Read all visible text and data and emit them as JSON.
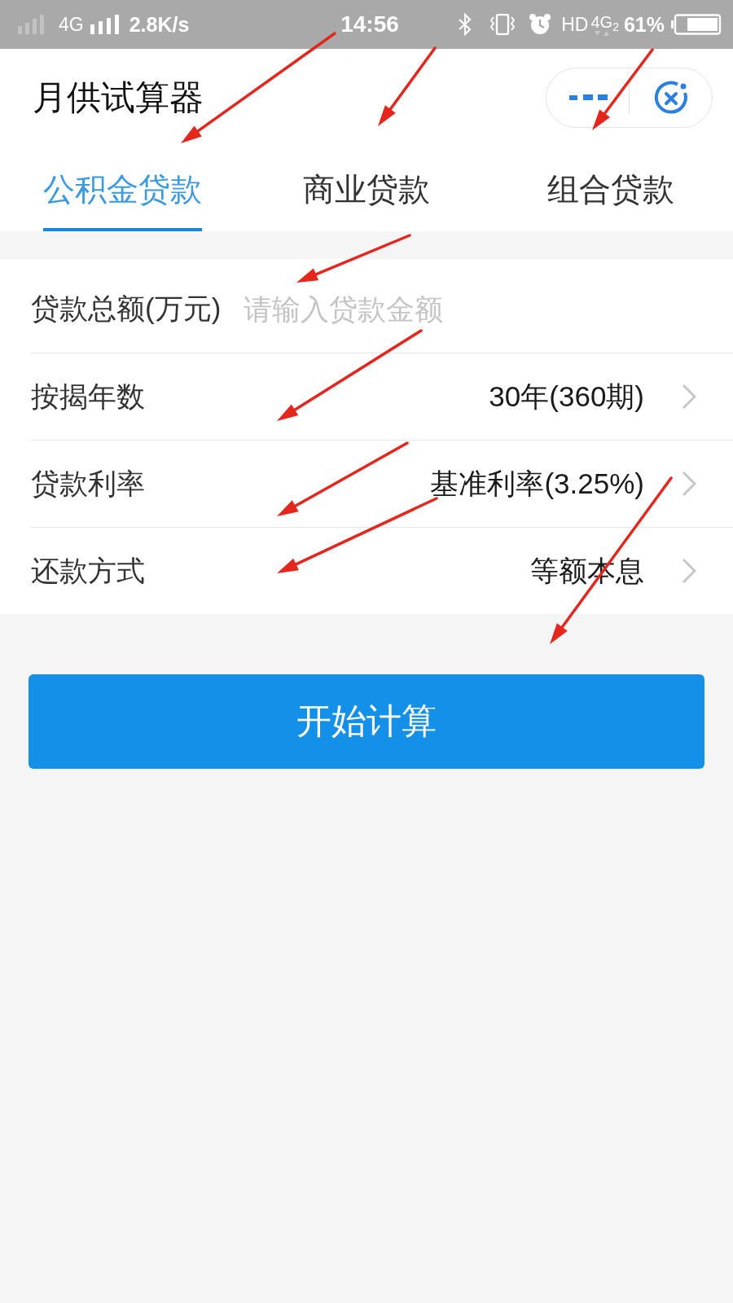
{
  "status_bar": {
    "network_1": "4G",
    "speed": "2.8K/s",
    "time": "14:56",
    "hd": "HD",
    "network_2": "4G",
    "sim_slot": "2",
    "battery_percent": "61%"
  },
  "header": {
    "title": "月供试算器"
  },
  "tabs": [
    {
      "label": "公积金贷款",
      "selected": true
    },
    {
      "label": "商业贷款",
      "selected": false
    },
    {
      "label": "组合贷款",
      "selected": false
    }
  ],
  "form": {
    "rows": [
      {
        "kind": "input",
        "label": "贷款总额(万元)",
        "placeholder": "请输入贷款金额"
      },
      {
        "kind": "select",
        "label": "按揭年数",
        "value": "30年(360期)"
      },
      {
        "kind": "select",
        "label": "贷款利率",
        "value": "基准利率(3.25%)"
      },
      {
        "kind": "select",
        "label": "还款方式",
        "value": "等额本息"
      }
    ]
  },
  "button": {
    "label": "开始计算"
  }
}
